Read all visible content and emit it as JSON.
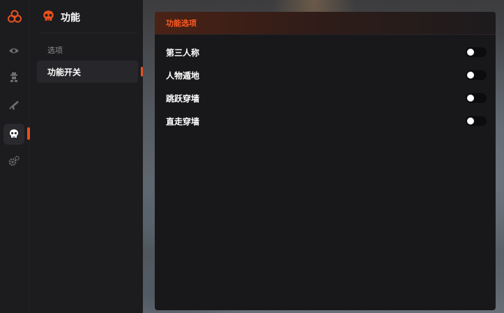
{
  "colors": {
    "accent": "#e8501e",
    "header_text": "#ff5a1f"
  },
  "rail": {
    "items": [
      {
        "icon": "eye-icon"
      },
      {
        "icon": "character-icon"
      },
      {
        "icon": "rifle-icon"
      },
      {
        "icon": "skull-icon",
        "active": true
      },
      {
        "icon": "settings-gears-icon"
      }
    ]
  },
  "subpanel": {
    "title": "功能",
    "section_label": "选项",
    "items": [
      {
        "label": "功能开关",
        "active": true
      }
    ]
  },
  "card": {
    "title": "功能选项",
    "options": [
      {
        "label": "第三人称",
        "enabled": false
      },
      {
        "label": "人物遁地",
        "enabled": false
      },
      {
        "label": "跳跃穿墙",
        "enabled": false
      },
      {
        "label": "直走穿墙",
        "enabled": false
      }
    ]
  }
}
